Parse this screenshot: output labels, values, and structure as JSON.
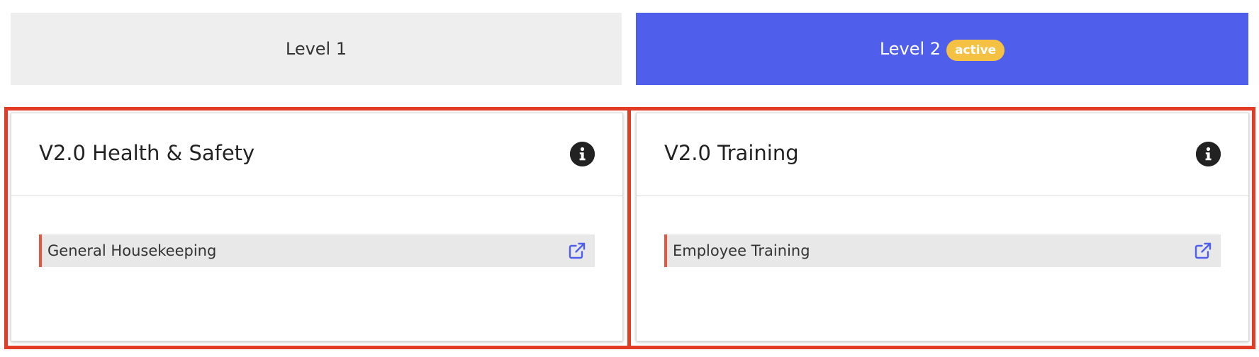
{
  "tabs": [
    {
      "label": "Level 1",
      "active": false
    },
    {
      "label": "Level 2",
      "active": true,
      "badge": "active"
    }
  ],
  "cards": [
    {
      "title": "V2.0 Health & Safety",
      "info_icon": "info-icon",
      "items": [
        {
          "label": "General Housekeeping",
          "icon": "external-link-icon"
        }
      ]
    },
    {
      "title": "V2.0 Training",
      "info_icon": "info-icon",
      "items": [
        {
          "label": "Employee Training",
          "icon": "external-link-icon"
        }
      ]
    }
  ],
  "colors": {
    "active_tab": "#4f5fec",
    "inactive_tab": "#eeeeee",
    "badge": "#f4c142",
    "highlight_frame": "#e23c27",
    "item_accent": "#e7573f",
    "link_icon": "#4f5fec"
  }
}
